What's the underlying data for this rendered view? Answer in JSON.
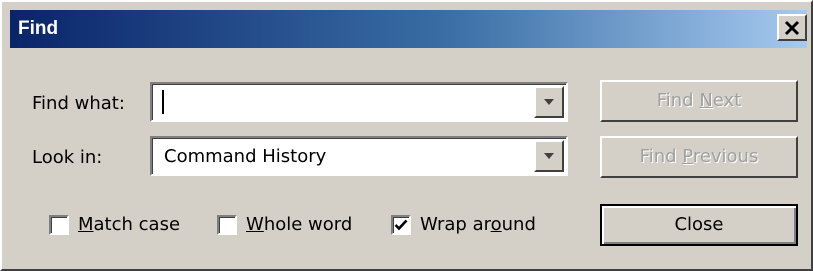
{
  "window": {
    "title": "Find",
    "close_icon": "close-icon"
  },
  "form": {
    "find_what_label": "Find what:",
    "find_what_value": "",
    "look_in_label": "Look in:",
    "look_in_value": "Command History"
  },
  "buttons": {
    "find_next": {
      "before": "Find ",
      "mnemonic": "N",
      "after": "ext",
      "enabled": false
    },
    "find_previous": {
      "before": "Find ",
      "mnemonic": "P",
      "after": "revious",
      "enabled": false
    },
    "close": {
      "label": "Close",
      "enabled": true
    }
  },
  "options": {
    "match_case": {
      "before": "",
      "mnemonic": "M",
      "after": "atch case",
      "checked": false
    },
    "whole_word": {
      "before": "",
      "mnemonic": "W",
      "after": "hole word",
      "checked": false
    },
    "wrap_around": {
      "before": "Wrap ar",
      "mnemonic": "o",
      "after": "und",
      "checked": true
    }
  },
  "colors": {
    "dialog_face": "#d4d0c8",
    "title_start": "#0a246a",
    "title_end": "#a6caf0",
    "disabled_text": "#a0a0a0"
  }
}
